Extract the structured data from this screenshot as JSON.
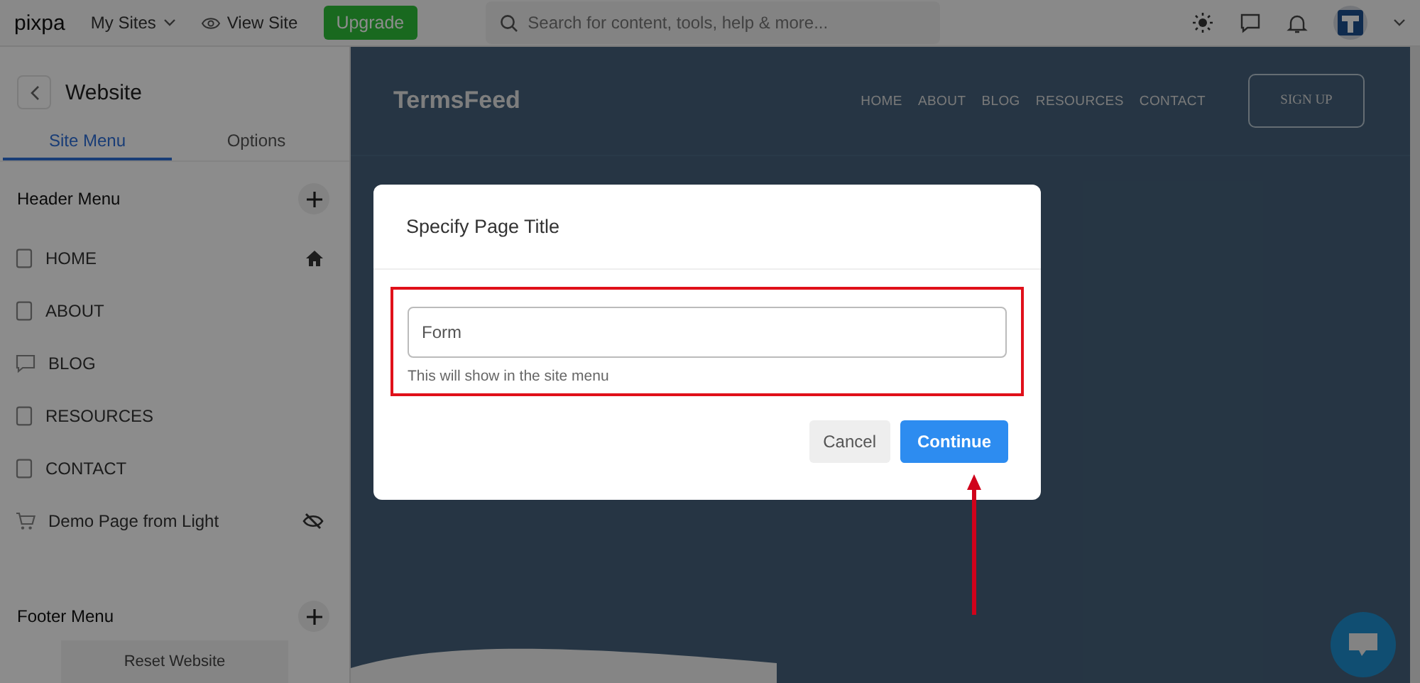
{
  "topbar": {
    "logo": "pixpa",
    "my_sites": "My Sites",
    "view_site": "View Site",
    "upgrade": "Upgrade",
    "search": {
      "placeholder": "Search for content, tools, help & more..."
    }
  },
  "sidebar": {
    "title": "Website",
    "tabs": [
      {
        "label": "Site Menu",
        "selected": true
      },
      {
        "label": "Options",
        "selected": false
      }
    ],
    "header_menu": "Header Menu",
    "items": [
      {
        "label": "HOME",
        "kind": "page",
        "home": true,
        "hidden": false
      },
      {
        "label": "ABOUT",
        "kind": "page",
        "home": false,
        "hidden": false
      },
      {
        "label": "BLOG",
        "kind": "blog",
        "home": false,
        "hidden": false
      },
      {
        "label": "RESOURCES",
        "kind": "page",
        "home": false,
        "hidden": false
      },
      {
        "label": "CONTACT",
        "kind": "page",
        "home": false,
        "hidden": false
      },
      {
        "label": "Demo Page from Light",
        "kind": "store",
        "home": false,
        "hidden": true
      }
    ],
    "footer_menu": "Footer Menu",
    "reset": "Reset Website"
  },
  "preview": {
    "brand": "TermsFeed",
    "nav": [
      "HOME",
      "ABOUT",
      "BLOG",
      "RESOURCES",
      "CONTACT"
    ],
    "signup": "SIGN UP"
  },
  "dialog": {
    "title": "Specify Page Title",
    "value": "Form",
    "hint": "This will show in the site menu",
    "cancel": "Cancel",
    "continue": "Continue"
  }
}
